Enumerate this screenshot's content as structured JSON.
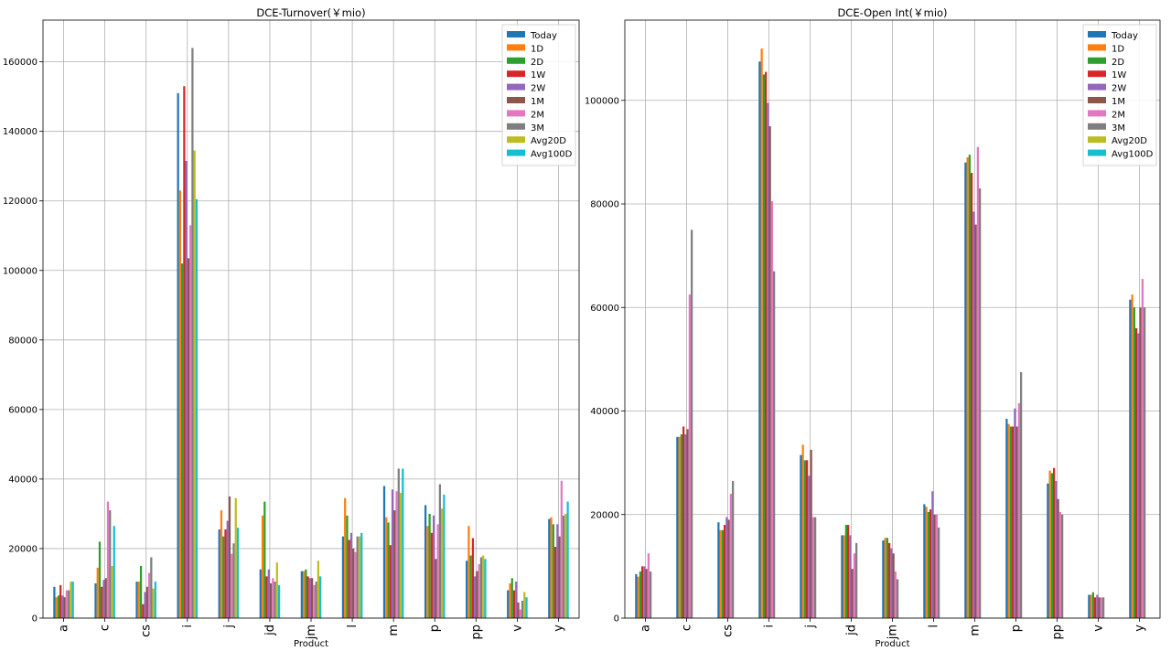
{
  "figure": {
    "xlabel": "Product"
  },
  "colors": [
    "#1f77b4",
    "#ff7f0e",
    "#2ca02c",
    "#d62728",
    "#9467bd",
    "#8c564b",
    "#e377c2",
    "#7f7f7f",
    "#bcbd22",
    "#17becf"
  ],
  "chart_data": [
    {
      "type": "bar",
      "title": "DCE-Turnover(￥mio)",
      "xlabel": "Product",
      "ylabel": "",
      "ylim": [
        0,
        172000
      ],
      "yticks": [
        0,
        20000,
        40000,
        60000,
        80000,
        100000,
        120000,
        140000,
        160000
      ],
      "grid": true,
      "legend_position": "top-right",
      "categories": [
        "a",
        "c",
        "cs",
        "i",
        "j",
        "jd",
        "jm",
        "l",
        "m",
        "p",
        "pp",
        "v",
        "y"
      ],
      "series": [
        {
          "name": "Today",
          "values": [
            9000,
            10000,
            10500,
            151000,
            25500,
            14000,
            13500,
            23500,
            38000,
            32500,
            16500,
            8000,
            28500
          ]
        },
        {
          "name": "1D",
          "values": [
            6000,
            14500,
            10500,
            123000,
            31000,
            29500,
            13500,
            34500,
            29000,
            26500,
            26500,
            10000,
            29000
          ]
        },
        {
          "name": "2D",
          "values": [
            6500,
            22000,
            15000,
            102000,
            23500,
            33500,
            14000,
            29500,
            27500,
            30000,
            18000,
            11500,
            27000
          ]
        },
        {
          "name": "1W",
          "values": [
            9500,
            9000,
            4000,
            153000,
            25500,
            12000,
            12000,
            22500,
            21000,
            24500,
            23000,
            8000,
            20500
          ]
        },
        {
          "name": "2W",
          "values": [
            6500,
            11000,
            7500,
            131500,
            28000,
            14000,
            11500,
            24500,
            37000,
            29500,
            12000,
            10500,
            27000
          ]
        },
        {
          "name": "1M",
          "values": [
            6000,
            11500,
            9000,
            103500,
            35000,
            10000,
            11500,
            20000,
            31000,
            17000,
            13500,
            4500,
            23500
          ]
        },
        {
          "name": "2M",
          "values": [
            8000,
            33500,
            13000,
            113000,
            18500,
            11500,
            9500,
            19000,
            36500,
            27000,
            15500,
            2500,
            39500
          ]
        },
        {
          "name": "3M",
          "values": [
            8000,
            31000,
            17500,
            164000,
            21500,
            10500,
            10500,
            23500,
            43000,
            38500,
            17500,
            5000,
            29500
          ]
        },
        {
          "name": "Avg20D",
          "values": [
            10500,
            15000,
            8500,
            134500,
            34500,
            16000,
            16500,
            23500,
            36000,
            31500,
            18000,
            7500,
            30000
          ]
        },
        {
          "name": "Avg100D",
          "values": [
            10500,
            26500,
            10500,
            120500,
            26000,
            9500,
            12000,
            24500,
            43000,
            35500,
            17000,
            6000,
            33500
          ]
        }
      ]
    },
    {
      "type": "bar",
      "title": "DCE-Open Int(￥mio)",
      "xlabel": "Product",
      "ylabel": "",
      "ylim": [
        0,
        115500
      ],
      "yticks": [
        0,
        20000,
        40000,
        60000,
        80000,
        100000
      ],
      "grid": true,
      "legend_position": "top-right",
      "categories": [
        "a",
        "c",
        "cs",
        "i",
        "j",
        "jd",
        "jm",
        "l",
        "m",
        "p",
        "pp",
        "v",
        "y"
      ],
      "series": [
        {
          "name": "Today",
          "values": [
            8500,
            35000,
            18500,
            107500,
            31500,
            16000,
            15000,
            22000,
            88000,
            38500,
            26000,
            4500,
            61500
          ]
        },
        {
          "name": "1D",
          "values": [
            8000,
            35000,
            17000,
            110000,
            33500,
            16000,
            15500,
            21500,
            89000,
            37500,
            28500,
            4500,
            62500
          ]
        },
        {
          "name": "2D",
          "values": [
            9000,
            35500,
            17000,
            105000,
            30500,
            18000,
            15500,
            20500,
            89500,
            37000,
            28000,
            5000,
            60000
          ]
        },
        {
          "name": "1W",
          "values": [
            10000,
            37000,
            18000,
            105500,
            30500,
            18000,
            14500,
            21000,
            86000,
            37000,
            29000,
            4000,
            56000
          ]
        },
        {
          "name": "2W",
          "values": [
            10000,
            35500,
            19500,
            99500,
            27500,
            16000,
            13500,
            24500,
            78500,
            40500,
            26500,
            4500,
            55000
          ]
        },
        {
          "name": "1M",
          "values": [
            9500,
            36500,
            19000,
            95000,
            32500,
            9500,
            12500,
            20000,
            76000,
            37000,
            23000,
            4000,
            60000
          ]
        },
        {
          "name": "2M",
          "values": [
            12500,
            62500,
            24000,
            80500,
            19500,
            12500,
            9000,
            20000,
            91000,
            41500,
            20500,
            4000,
            65500
          ]
        },
        {
          "name": "3M",
          "values": [
            9000,
            75000,
            26500,
            67000,
            19500,
            14500,
            7500,
            17500,
            83000,
            47500,
            20000,
            4000,
            60000
          ]
        },
        {
          "name": "Avg20D",
          "values": [
            null,
            null,
            null,
            null,
            null,
            null,
            null,
            null,
            null,
            null,
            null,
            null,
            null
          ]
        },
        {
          "name": "Avg100D",
          "values": [
            null,
            null,
            null,
            null,
            null,
            null,
            null,
            null,
            null,
            null,
            null,
            null,
            null
          ]
        }
      ]
    }
  ]
}
